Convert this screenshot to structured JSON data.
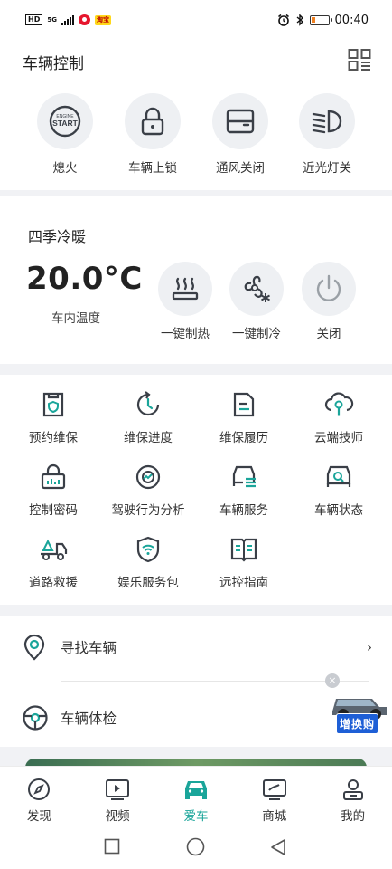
{
  "status_bar": {
    "hd": "HD",
    "network": "5G",
    "app_badge": "淘宝",
    "time": "00:40"
  },
  "header": {
    "title": "车辆控制"
  },
  "quick_actions": [
    {
      "label": "熄火",
      "icon": "engine-start-icon",
      "icon_text_top": "ENGINE",
      "icon_text_bottom": "START"
    },
    {
      "label": "车辆上锁",
      "icon": "lock-icon"
    },
    {
      "label": "通风关闭",
      "icon": "car-window-icon"
    },
    {
      "label": "近光灯关",
      "icon": "low-beam-icon"
    }
  ],
  "climate": {
    "title": "四季冷暖",
    "temperature": "20.0°C",
    "temperature_label": "车内温度",
    "actions": [
      {
        "label": "一键制热",
        "icon": "heat-icon"
      },
      {
        "label": "一键制冷",
        "icon": "fan-snow-icon"
      },
      {
        "label": "关闭",
        "icon": "power-icon"
      }
    ]
  },
  "services": [
    {
      "label": "预约维保",
      "icon": "maintenance-booking-icon"
    },
    {
      "label": "维保进度",
      "icon": "progress-clock-icon"
    },
    {
      "label": "维保履历",
      "icon": "history-document-icon"
    },
    {
      "label": "云端技师",
      "icon": "cloud-technician-icon"
    },
    {
      "label": "控制密码",
      "icon": "password-lock-icon"
    },
    {
      "label": "驾驶行为分析",
      "icon": "driving-analysis-icon"
    },
    {
      "label": "车辆服务",
      "icon": "vehicle-service-icon"
    },
    {
      "label": "车辆状态",
      "icon": "vehicle-status-icon"
    },
    {
      "label": "道路救援",
      "icon": "road-rescue-icon"
    },
    {
      "label": "娱乐服务包",
      "icon": "wifi-shield-icon"
    },
    {
      "label": "远控指南",
      "icon": "guide-book-icon"
    }
  ],
  "finder": {
    "find_vehicle": "寻找车辆",
    "vehicle_check": "车辆体检",
    "chevron": "›"
  },
  "promo": {
    "close": "×",
    "label": "增换购"
  },
  "tabs": [
    {
      "label": "发现",
      "icon": "compass-icon",
      "active": false
    },
    {
      "label": "视频",
      "icon": "video-play-icon",
      "active": false
    },
    {
      "label": "爱车",
      "icon": "car-icon",
      "active": true
    },
    {
      "label": "商城",
      "icon": "shop-icon",
      "active": false
    },
    {
      "label": "我的",
      "icon": "user-icon",
      "active": false
    }
  ],
  "colors": {
    "accent": "#1aa59a",
    "icon": "#3a3f47",
    "background": "#f1f2f5"
  }
}
